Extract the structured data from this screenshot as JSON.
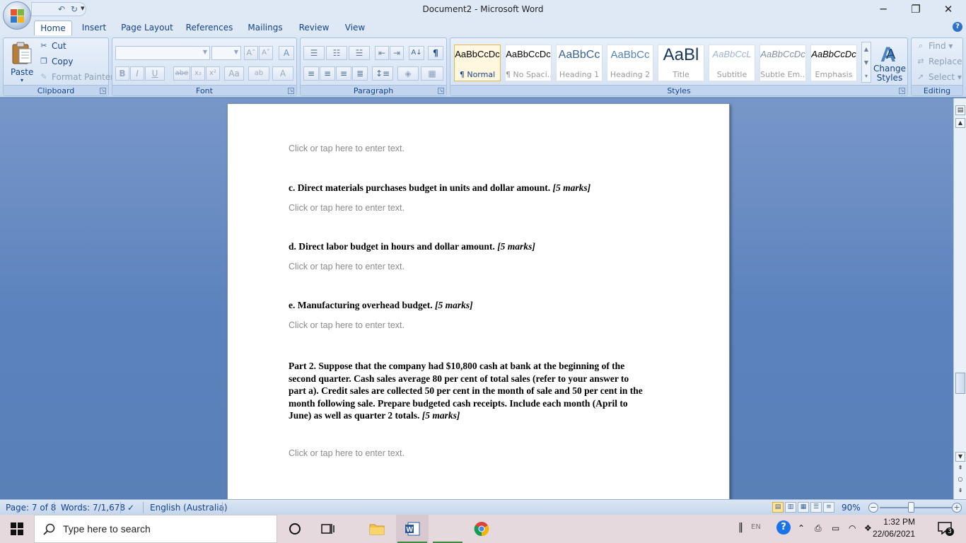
{
  "window": {
    "title": "Document2 - Microsoft Word",
    "controls": {
      "minimize": "─",
      "restore": "❐",
      "close": "✕"
    }
  },
  "quick_access": {
    "undo": "↶",
    "redo": "↻",
    "customize": "▾"
  },
  "tabs": [
    {
      "label": "Home",
      "active": true
    },
    {
      "label": "Insert"
    },
    {
      "label": "Page Layout"
    },
    {
      "label": "References"
    },
    {
      "label": "Mailings"
    },
    {
      "label": "Review"
    },
    {
      "label": "View"
    }
  ],
  "help": "?",
  "ribbon": {
    "clipboard": {
      "label": "Clipboard",
      "paste": "Paste",
      "cut": "Cut",
      "copy": "Copy",
      "format_painter": "Format Painter"
    },
    "font": {
      "label": "Font",
      "grow": "A˄",
      "shrink": "A˅",
      "clear": "A",
      "bold": "B",
      "italic": "I",
      "underline": "U",
      "strike": "abe",
      "subscript": "x₂",
      "superscript": "x²",
      "change_case": "Aa",
      "highlight": "ab",
      "color": "A"
    },
    "paragraph": {
      "label": "Paragraph",
      "sort": "A↓",
      "show_marks": "¶"
    },
    "styles": {
      "label": "Styles",
      "items": [
        {
          "sample": "AaBbCcDc",
          "name": "¶ Normal",
          "active": true
        },
        {
          "sample": "AaBbCcDc",
          "name": "¶ No Spaci..."
        },
        {
          "sample": "AaBbCc",
          "name": "Heading 1"
        },
        {
          "sample": "AaBbCc",
          "name": "Heading 2"
        },
        {
          "sample": "AaBl",
          "name": "Title"
        },
        {
          "sample": "AaBbCcL",
          "name": "Subtitle"
        },
        {
          "sample": "AaBbCcDc",
          "name": "Subtle Em..."
        },
        {
          "sample": "AaBbCcDc",
          "name": "Emphasis"
        }
      ],
      "change_styles_1": "Change",
      "change_styles_2": "Styles ▾"
    },
    "editing": {
      "label": "Editing",
      "find": "Find ▾",
      "replace": "Replace",
      "select": "Select ▾"
    }
  },
  "document": {
    "placeholder": "Click or tap here to enter text.",
    "q_c": {
      "text": "c. Direct materials purchases budget in units and dollar amount.",
      "marks": "[5 marks]"
    },
    "q_d": {
      "text": "d. Direct labor budget in hours and dollar amount.",
      "marks": "[5 marks]"
    },
    "q_e": {
      "text": "e. Manufacturing overhead budget.",
      "marks": "[5 marks]"
    },
    "part2": {
      "line1": "Part 2. Suppose that the company had $10,800 cash at bank at the beginning of the",
      "line2": "second quarter. Cash sales average 80 per cent of total sales (refer to your answer to",
      "line3": "part a). Credit sales are collected 50 per cent in the month of sale and 50 per cent in the",
      "line4": "month following sale. Prepare budgeted cash receipts. Include each month (April to",
      "line5": "June) as well as quarter 2 totals.",
      "marks": "[5 marks]"
    }
  },
  "status": {
    "page": "Page: 7 of 8",
    "words": "Words: 7/1,678",
    "language": "English (Australia)",
    "zoom": "90%"
  },
  "taskbar": {
    "search_placeholder": "Type here to search",
    "lang": "EN",
    "time": "1:32 PM",
    "date": "22/06/2021",
    "notifications": "3"
  }
}
